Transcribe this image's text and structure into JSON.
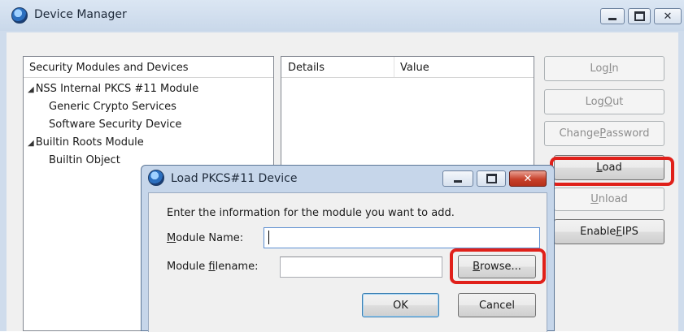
{
  "main_window": {
    "title": "Device Manager",
    "tree": {
      "header": "Security Modules and Devices",
      "items": [
        {
          "label": "NSS Internal PKCS #11 Module",
          "level": 0,
          "expanded": true
        },
        {
          "label": "Generic Crypto Services",
          "level": 1
        },
        {
          "label": "Software Security Device",
          "level": 1
        },
        {
          "label": "Builtin Roots Module",
          "level": 0,
          "expanded": true
        },
        {
          "label": "Builtin Object",
          "level": 1
        }
      ]
    },
    "details": {
      "col_details": "Details",
      "col_value": "Value"
    },
    "buttons": {
      "login": {
        "pre": "Log ",
        "key": "I",
        "post": "n"
      },
      "logout": {
        "pre": "Log ",
        "key": "O",
        "post": "ut"
      },
      "change_password": {
        "pre": "Change ",
        "key": "P",
        "post": "assword"
      },
      "load": {
        "pre": "",
        "key": "L",
        "post": "oad"
      },
      "unload": {
        "pre": "",
        "key": "U",
        "post": "nload"
      },
      "enable_fips": {
        "pre": "Enable ",
        "key": "F",
        "post": "IPS"
      }
    }
  },
  "dialog": {
    "title": "Load PKCS#11 Device",
    "instruction": "Enter the information for the module you want to add.",
    "module_name": {
      "pre": "",
      "key": "M",
      "post": "odule Name:",
      "value": ""
    },
    "module_filename": {
      "pre": "Module ",
      "key": "f",
      "post": "ilename:",
      "value": ""
    },
    "browse": {
      "pre": "",
      "key": "B",
      "post": "rowse..."
    },
    "ok": "OK",
    "cancel": "Cancel"
  },
  "colors": {
    "highlight": "#e0201a",
    "title_bar": "#cfdcec",
    "close_button": "#c7402a"
  }
}
